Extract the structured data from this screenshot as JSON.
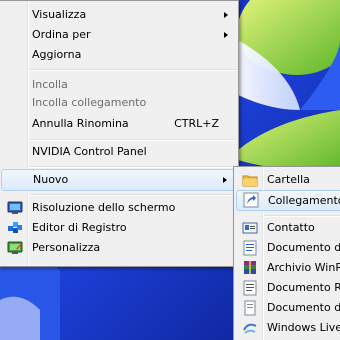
{
  "colors": {
    "desktop_blue": "#1a3fcf",
    "desktop_green": "#7fcc2a",
    "menu_bg": "#f0f0f0",
    "menu_border": "#979797",
    "highlight": "#dceaf9"
  },
  "context_menu": {
    "items": [
      {
        "label": "Visualizza",
        "submenu": true
      },
      {
        "label": "Ordina per",
        "submenu": true
      },
      {
        "label": "Aggiorna"
      },
      {
        "label": "Incolla",
        "disabled": true
      },
      {
        "label": "Incolla collegamento",
        "disabled": true
      },
      {
        "label": "Annulla Rinomina",
        "shortcut": "CTRL+Z"
      },
      {
        "label": "NVIDIA Control Panel"
      },
      {
        "label": "Nuovo",
        "submenu": true,
        "highlighted": true
      },
      {
        "label": "Risoluzione dello schermo",
        "icon": "monitor-icon"
      },
      {
        "label": "Editor di Registro",
        "icon": "registry-editor-icon"
      },
      {
        "label": "Personalizza",
        "icon": "personalize-icon"
      }
    ]
  },
  "submenu_nuovo": {
    "items": [
      {
        "label": "Cartella",
        "icon": "folder-icon"
      },
      {
        "label": "Collegamento",
        "icon": "shortcut-icon",
        "highlighted": true
      },
      {
        "label": "Contatto",
        "icon": "contact-card-icon"
      },
      {
        "label": "Documento di",
        "icon": "word-document-icon"
      },
      {
        "label": "Archivio WinRA",
        "icon": "winrar-archive-icon"
      },
      {
        "label": "Documento RT",
        "icon": "rtf-document-icon"
      },
      {
        "label": "Documento di",
        "icon": "text-document-icon"
      },
      {
        "label": "Windows Live C",
        "icon": "windows-live-icon"
      }
    ]
  }
}
